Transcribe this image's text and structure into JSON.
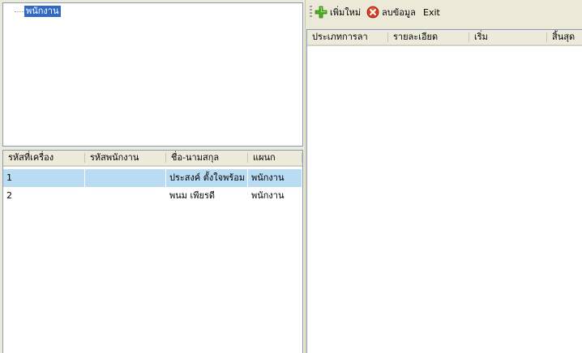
{
  "tree": {
    "root_label": "พนักงาน"
  },
  "employee_grid": {
    "columns": [
      "รหัสที่เครื่อง",
      "รหัสพนักงาน",
      "ชื่อ-นามสกุล",
      "แผนก"
    ],
    "rows": [
      {
        "machine_id": "1",
        "employee_id": "",
        "name": "ประสงค์ ตั้งใจพร้อม",
        "department": "พนักงาน",
        "selected": true
      },
      {
        "machine_id": "2",
        "employee_id": "",
        "name": "พนม เพียรดี",
        "department": "พนักงาน",
        "selected": false
      }
    ]
  },
  "toolbar": {
    "add_label": "เพิ่มใหม่",
    "delete_label": "ลบข้อมูล",
    "exit_label": "Exit"
  },
  "leave_grid": {
    "columns": [
      "ประเภทการลา",
      "รายละเอียด",
      "เริ่ม",
      "สิ้นสุด"
    ]
  },
  "colors": {
    "selection": "#316ac5",
    "selected_row": "#b9dcf3",
    "add_icon": "#4caf1f",
    "delete_icon": "#d83a1e"
  }
}
